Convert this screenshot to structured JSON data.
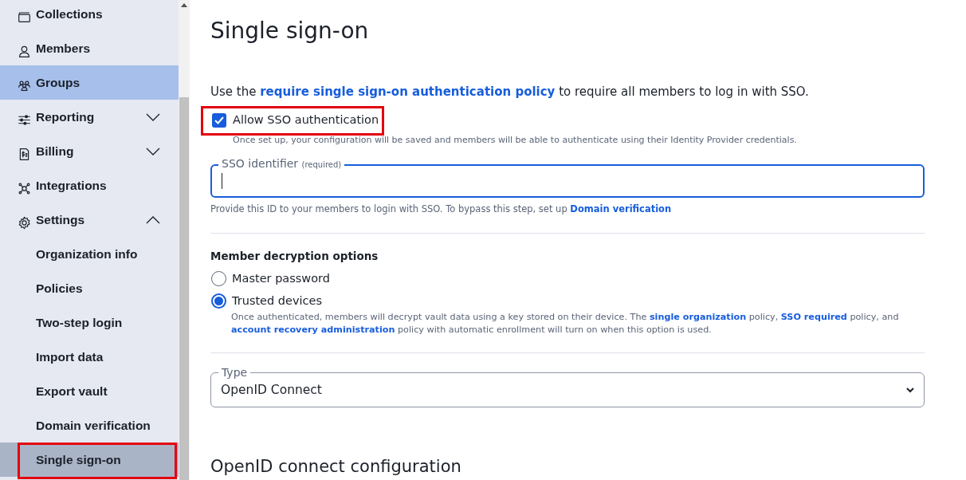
{
  "sidebar": {
    "items": [
      {
        "label": "Collections",
        "kind": "link",
        "selected": false,
        "hovered": false,
        "outlined": false
      },
      {
        "label": "Members",
        "kind": "link",
        "selected": false,
        "hovered": false,
        "outlined": false
      },
      {
        "label": "Groups",
        "kind": "link",
        "selected": false,
        "hovered": true,
        "outlined": false
      },
      {
        "label": "Reporting",
        "kind": "group",
        "expanded": false,
        "selected": false,
        "hovered": false,
        "outlined": false
      },
      {
        "label": "Billing",
        "kind": "group",
        "expanded": false,
        "selected": false,
        "hovered": false,
        "outlined": false
      },
      {
        "label": "Integrations",
        "kind": "link",
        "selected": false,
        "hovered": false,
        "outlined": false
      },
      {
        "label": "Settings",
        "kind": "group",
        "expanded": true,
        "selected": false,
        "hovered": false,
        "outlined": false,
        "children": [
          {
            "label": "Organization info",
            "selected": false,
            "outlined": false
          },
          {
            "label": "Policies",
            "selected": false,
            "outlined": false
          },
          {
            "label": "Two-step login",
            "selected": false,
            "outlined": false
          },
          {
            "label": "Import data",
            "selected": false,
            "outlined": false
          },
          {
            "label": "Export vault",
            "selected": false,
            "outlined": false
          },
          {
            "label": "Domain verification",
            "selected": false,
            "outlined": false
          },
          {
            "label": "Single sign-on",
            "selected": true,
            "outlined": true
          }
        ]
      }
    ]
  },
  "page": {
    "title": "Single sign-on",
    "intro": [
      {
        "kind": "text",
        "text": "Use the "
      },
      {
        "kind": "link",
        "text": "require single sign-on authentication policy"
      },
      {
        "kind": "text",
        "text": " to require all members to log in with SSO."
      }
    ],
    "allow_sso": {
      "label": "Allow SSO authentication",
      "checked": true,
      "outlined": true,
      "hint": "Once set up, your configuration will be saved and members will be able to authenticate using their Identity Provider credentials."
    },
    "sso_identifier": {
      "label": "SSO identifier",
      "note": "(required)",
      "focused": true,
      "help": [
        {
          "kind": "text",
          "text": "Provide this ID to your members to login with SSO. To bypass this step, set up "
        },
        {
          "kind": "link",
          "text": "Domain verification"
        }
      ]
    },
    "decryption": {
      "heading": "Member decryption options",
      "options": [
        {
          "label": "Master password",
          "selected": false
        },
        {
          "label": "Trusted devices",
          "selected": true,
          "description": [
            {
              "kind": "text",
              "text": "Once authenticated, members will decrypt vault data using a key stored on their device. The "
            },
            {
              "kind": "link",
              "text": "single organization"
            },
            {
              "kind": "text",
              "text": " policy, "
            },
            {
              "kind": "link",
              "text": "SSO required"
            },
            {
              "kind": "text",
              "text": " policy, and "
            },
            {
              "kind": "link",
              "text": "account recovery administration"
            },
            {
              "kind": "text",
              "text": " policy with automatic enrollment will turn on when this option is used."
            }
          ]
        }
      ]
    },
    "type": {
      "label": "Type",
      "value": "OpenID Connect"
    },
    "section_heading": "OpenID connect configuration"
  }
}
